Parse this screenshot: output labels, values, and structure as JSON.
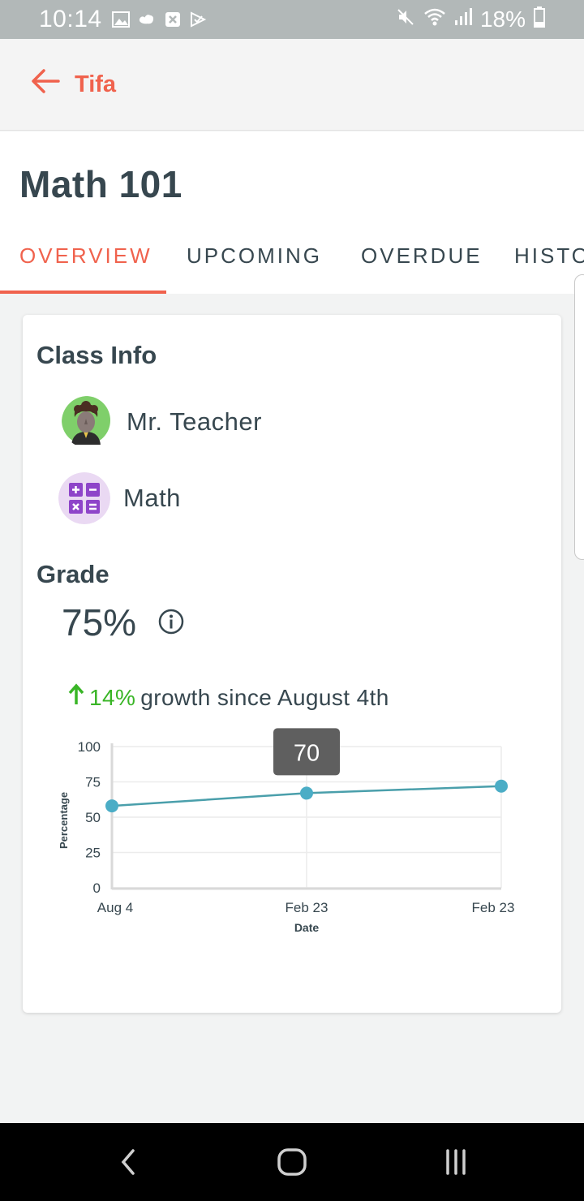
{
  "status_bar": {
    "time": "10:14",
    "battery": "18%",
    "icons": [
      "gallery-icon",
      "cloud-icon",
      "close-box-icon",
      "play-check-icon",
      "mute-icon",
      "wifi-icon",
      "signal-icon",
      "battery-icon"
    ]
  },
  "app_bar": {
    "back_label": "Tifa"
  },
  "page": {
    "title": "Math 101"
  },
  "tabs": [
    "OVERVIEW",
    "UPCOMING",
    "OVERDUE",
    "HISTO"
  ],
  "class_info": {
    "heading": "Class Info",
    "teacher": "Mr. Teacher",
    "subject": "Math"
  },
  "grade": {
    "heading": "Grade",
    "value": "75%",
    "growth_pct": "14%",
    "growth_text": "growth since August 4th"
  },
  "chart_data": {
    "type": "line",
    "categories": [
      "Aug 4",
      "Feb 23",
      "Feb 23"
    ],
    "values": [
      58,
      67,
      72
    ],
    "xlabel": "Date",
    "ylabel": "Percentage",
    "ylim": [
      0,
      100
    ],
    "yticks": [
      0,
      25,
      50,
      75,
      100
    ],
    "tooltip": "70",
    "grid": true,
    "color": "#4badc6"
  },
  "colors": {
    "accent": "#f0624d",
    "growth": "#39b526",
    "text": "#37474f"
  }
}
